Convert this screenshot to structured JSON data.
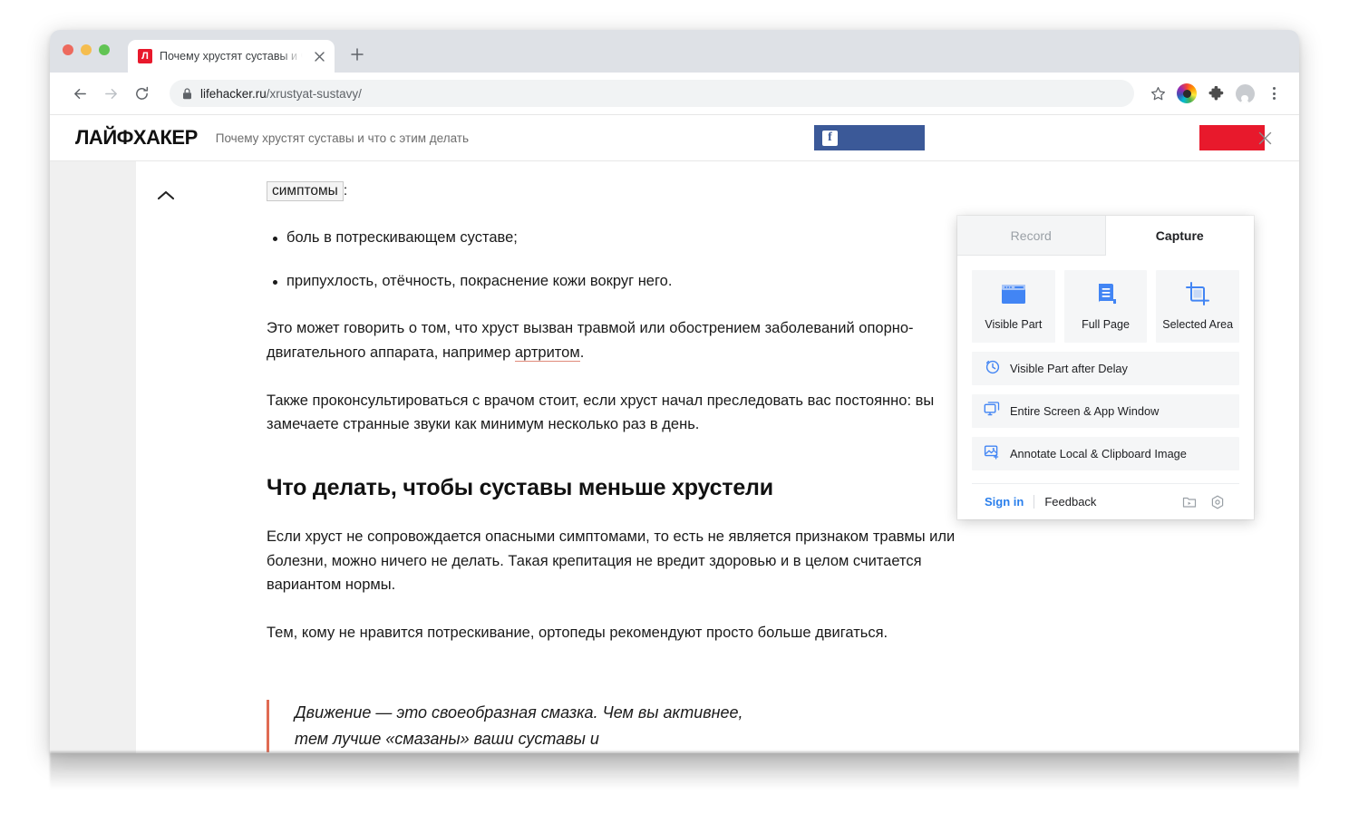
{
  "browser": {
    "tab": {
      "favicon_letter": "Л",
      "title": "Почему хрустят суставы и что с этим делать",
      "close_icon": "close-icon"
    },
    "new_tab_label": "+",
    "toolbar": {
      "back_icon": "back-arrow-icon",
      "forward_icon": "forward-arrow-icon",
      "reload_icon": "reload-icon",
      "lock_icon": "lock-icon",
      "url_domain": "lifehacker.ru",
      "url_path": "/xrustyat-sustavy/",
      "bookmark_icon": "star-icon",
      "extension_icon": "rainbow-extension-icon",
      "puzzle_icon": "puzzle-piece-icon",
      "profile_icon": "profile-avatar-icon",
      "menu_icon": "kebab-menu-icon"
    }
  },
  "site_header": {
    "logo": "ЛАЙФХАКЕР",
    "article_title": "Почему хрустят суставы и что с этим делать",
    "facebook_label": "f",
    "close_icon": "close-icon"
  },
  "article": {
    "collapse_icon": "chevron-up-icon",
    "tag_word": "симптомы",
    "tag_suffix": ":",
    "bullets": [
      "боль в потрескивающем суставе;",
      "припухлость, отёчность, покраснение кожи вокруг него."
    ],
    "para_1_before": "Это может говорить о том, что хруст вызван травмой или обострением заболеваний опорно-двигательного аппарата, например ",
    "para_1_link": "артритом",
    "para_1_after": ".",
    "para_2": "Также проконсультироваться с врачом стоит, если хруст начал преследовать вас постоянно: вы замечаете странные звуки как минимум несколько раз в день.",
    "heading": "Что делать, чтобы суставы меньше хрустели",
    "para_3": "Если хруст не сопровождается опасными симптомами, то есть не является признаком травмы или болезни, можно ничего не делать. Такая крепитация не вредит здоровью и в целом считается вариантом нормы.",
    "para_4": "Тем, кому не нравится потрескивание, ортопеды рекомендуют просто больше двигаться.",
    "quote": "Движение — это своеобразная смазка. Чем вы активнее, тем лучше «смазаны» ваши суставы и"
  },
  "popup": {
    "tabs": [
      {
        "label": "Record",
        "active": false
      },
      {
        "label": "Capture",
        "active": true
      }
    ],
    "tiles": [
      {
        "label": "Visible Part",
        "icon": "browser-window-icon"
      },
      {
        "label": "Full Page",
        "icon": "full-page-icon"
      },
      {
        "label": "Selected Area",
        "icon": "crop-icon"
      }
    ],
    "rows": [
      {
        "label": "Visible Part after Delay",
        "icon": "clock-icon"
      },
      {
        "label": "Entire Screen & App Window",
        "icon": "monitor-icon"
      },
      {
        "label": "Annotate Local & Clipboard Image",
        "icon": "image-plus-icon"
      }
    ],
    "footer": {
      "sign_in": "Sign in",
      "feedback": "Feedback",
      "library_icon": "video-folder-icon",
      "settings_icon": "gear-hexagon-icon"
    }
  },
  "colors": {
    "accent_blue": "#4285f4",
    "link_blue": "#2a7fec",
    "brand_red": "#e8192c",
    "facebook_blue": "#3b5998",
    "quote_bar": "#e06b53"
  }
}
